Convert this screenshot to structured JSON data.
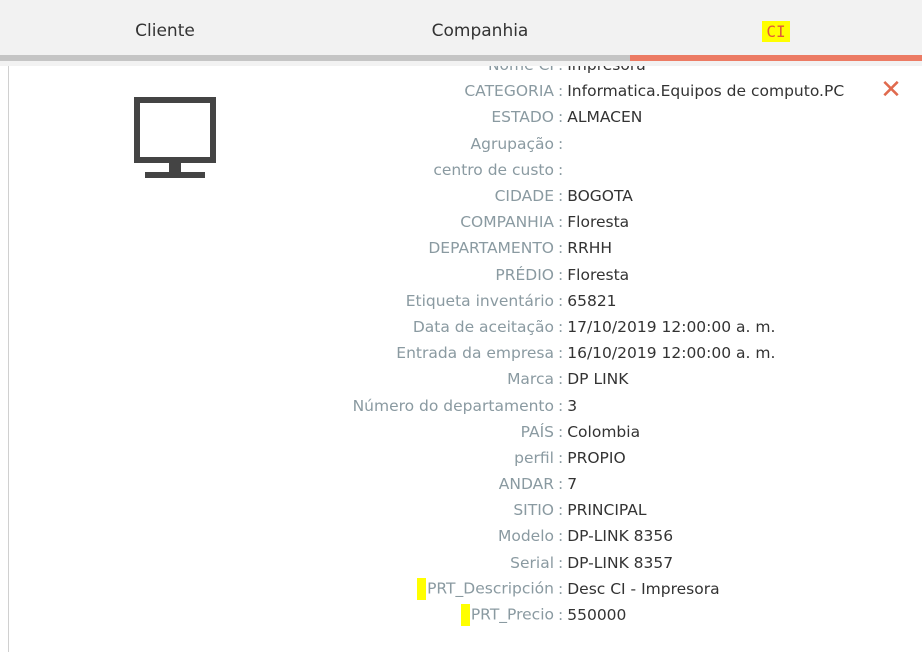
{
  "tabs": {
    "cliente": "Cliente",
    "companhia": "Companhia",
    "ci": "CI"
  },
  "colors": {
    "active_tab_underline": "#ec7b64",
    "close_icon": "#e06a4e",
    "highlight": "#ffff00",
    "label_text": "#8a9aa1"
  },
  "panel": {
    "icon": "monitor-icon",
    "close_icon": "close-icon",
    "close_glyph": "✕",
    "separator": ":",
    "fields": [
      {
        "label": "Nome CI",
        "value": "Impresora"
      },
      {
        "label": "CATEGORIA",
        "value": "Informatica.Equipos de computo.PC"
      },
      {
        "label": "ESTADO",
        "value": "ALMACEN"
      },
      {
        "label": "Agrupação",
        "value": ""
      },
      {
        "label": "centro de custo",
        "value": ""
      },
      {
        "label": "CIDADE",
        "value": "BOGOTA"
      },
      {
        "label": "COMPANHIA",
        "value": "Floresta"
      },
      {
        "label": "DEPARTAMENTO",
        "value": "RRHH"
      },
      {
        "label": "PRÉDIO",
        "value": "Floresta"
      },
      {
        "label": "Etiqueta inventário",
        "value": "65821"
      },
      {
        "label": "Data de aceitação",
        "value": "17/10/2019 12:00:00 a. m."
      },
      {
        "label": "Entrada da empresa",
        "value": "16/10/2019 12:00:00 a. m."
      },
      {
        "label": "Marca",
        "value": "DP LINK"
      },
      {
        "label": "Número do departamento",
        "value": "3"
      },
      {
        "label": "PAÍS",
        "value": "Colombia"
      },
      {
        "label": "perfil",
        "value": "PROPIO"
      },
      {
        "label": "ANDAR",
        "value": "7"
      },
      {
        "label": "SITIO",
        "value": "PRINCIPAL"
      },
      {
        "label": "Modelo",
        "value": "DP-LINK 8356"
      },
      {
        "label": "Serial",
        "value": "DP-LINK 8357"
      },
      {
        "label": "PRT_Descripción",
        "value": "Desc CI - Impresora"
      },
      {
        "label": "PRT_Precio",
        "value": "550000"
      }
    ]
  }
}
